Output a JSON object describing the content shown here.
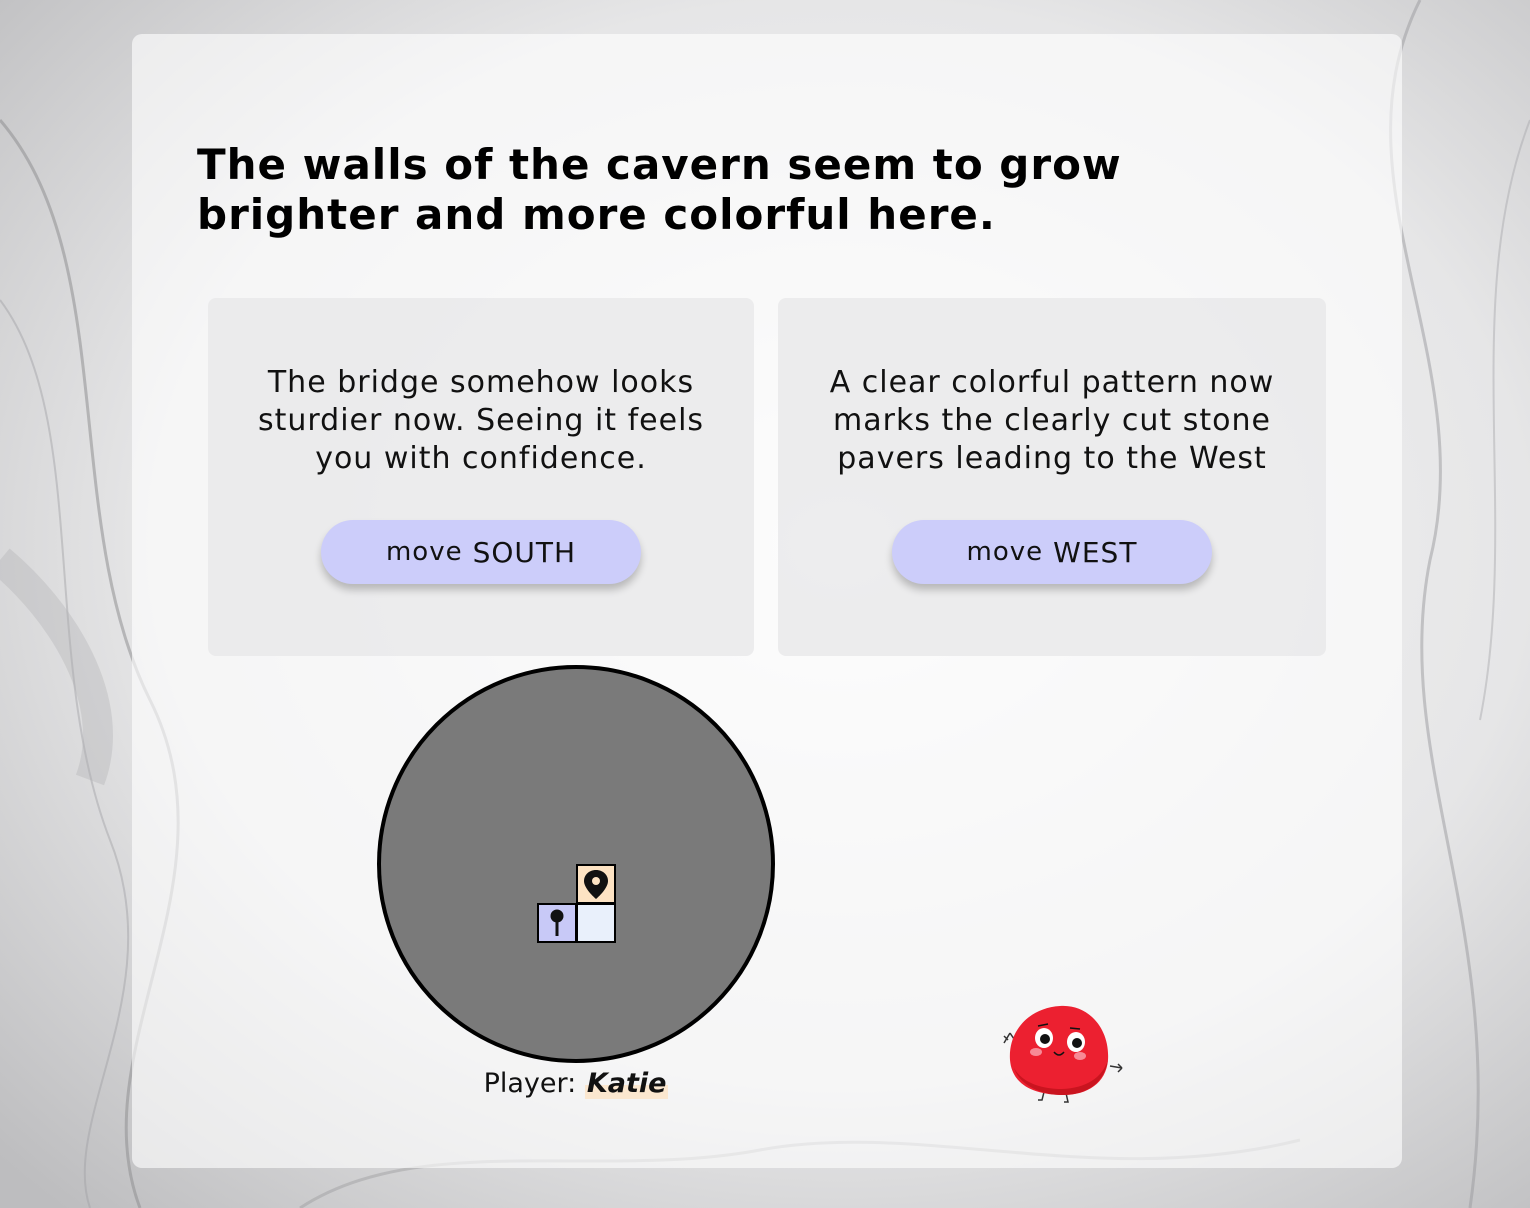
{
  "scene": {
    "title": "The walls of the cavern seem to grow brighter and more colorful here."
  },
  "options": [
    {
      "description": "The bridge somehow looks sturdier now. Seeing it feels you with confidence.",
      "button_verb": "move",
      "button_direction": "SOUTH"
    },
    {
      "description": "A clear colorful pattern now marks the clearly cut stone pavers leading to the West",
      "button_verb": "move",
      "button_direction": "WEST"
    }
  ],
  "map": {
    "current_room_icon": "map-pin-icon",
    "visited_room_icon": "push-pin-icon",
    "colors": {
      "circle": "#7a7a7a",
      "current_room": "#fde3c3",
      "visited_room": "#c8c9f7",
      "empty_room": "#e9f0fb"
    }
  },
  "player": {
    "label": "Player:",
    "name": "Katie"
  },
  "mascot": {
    "icon": "red-blob-character-icon",
    "color": "#ec2030"
  },
  "colors": {
    "button": "#cccdfa",
    "name_highlight": "#fbe7cf"
  }
}
